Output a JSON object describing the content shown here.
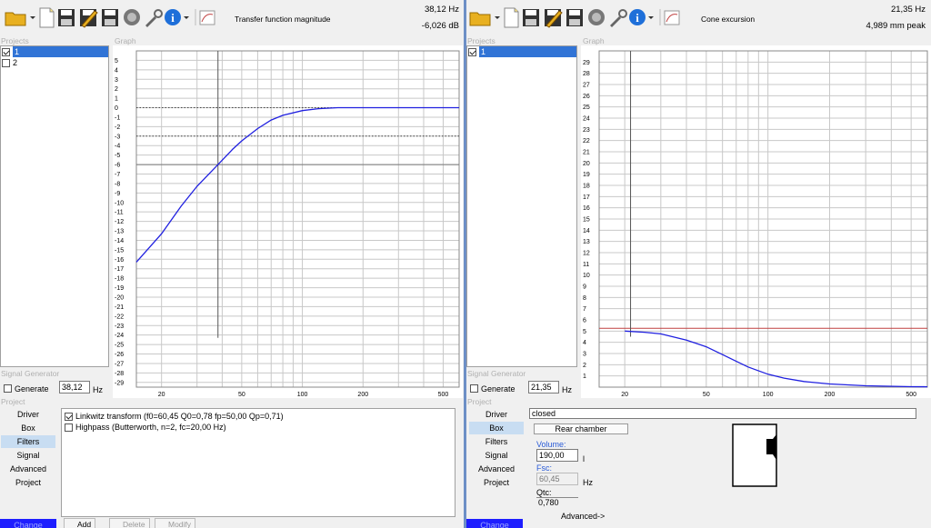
{
  "left": {
    "toolbar": {
      "title": "Transfer function magnitude",
      "readout_line1": "38,12 Hz",
      "readout_line2": "-6,026 dB"
    },
    "projects_label": "Projects",
    "graph_label": "Graph",
    "projects": [
      {
        "label": "1",
        "checked": true,
        "selected": true
      },
      {
        "label": "2",
        "checked": false,
        "selected": false
      }
    ],
    "signal_generator_label": "Signal Generator",
    "generate_label": "Generate",
    "generate_freq": "38,12",
    "generate_unit": "Hz",
    "project_label": "Project",
    "nav": [
      "Driver",
      "Box",
      "Filters",
      "Signal",
      "Advanced",
      "Project"
    ],
    "nav_selected": "Filters",
    "filters": [
      {
        "label": "Linkwitz transform (f0=60,45 Q0=0,78 fp=50,00 Qp=0,71)",
        "checked": true
      },
      {
        "label": "Highpass (Butterworth, n=2, fc=20,00 Hz)",
        "checked": false
      }
    ],
    "buttons": {
      "change": "Change",
      "add": "Add",
      "delete": "Delete",
      "modify": "Modify"
    }
  },
  "right": {
    "toolbar": {
      "title": "Cone excursion",
      "readout_line1": "21,35 Hz",
      "readout_line2": "4,989 mm peak"
    },
    "projects_label": "Projects",
    "graph_label": "Graph",
    "projects": [
      {
        "label": "1",
        "checked": true,
        "selected": true
      }
    ],
    "signal_generator_label": "Signal Generator",
    "generate_label": "Generate",
    "generate_freq": "21,35",
    "generate_unit": "Hz",
    "project_label": "Project",
    "nav": [
      "Driver",
      "Box",
      "Filters",
      "Signal",
      "Advanced",
      "Project"
    ],
    "nav_selected": "Box",
    "box": {
      "type": "closed",
      "rear_chamber": "Rear chamber",
      "volume_label": "Volume:",
      "volume_value": "190,00",
      "volume_unit": "l",
      "fsc_label": "Fsc:",
      "fsc_value": "60,45",
      "fsc_unit": "Hz",
      "qtc_label": "Qtc:",
      "qtc_value": "0,780",
      "advanced": "Advanced->"
    },
    "buttons": {
      "change": "Change"
    }
  },
  "chart_data": [
    {
      "type": "line",
      "title": "",
      "xlabel": "",
      "ylabel": "",
      "x_scale": "log",
      "xlim": [
        15,
        600
      ],
      "ylim": [
        -29.5,
        6
      ],
      "x_ticks": [
        "20",
        "50",
        "100",
        "200",
        "500"
      ],
      "y_ticks": [
        "5",
        "4",
        "3",
        "2",
        "1",
        "0",
        "-1",
        "-2",
        "-3",
        "-4",
        "-5",
        "-6",
        "-7",
        "-8",
        "-9",
        "-10",
        "-11",
        "-12",
        "-13",
        "-14",
        "-15",
        "-16",
        "-17",
        "-18",
        "-19",
        "-20",
        "-21",
        "-22",
        "-23",
        "-24",
        "-25",
        "-26",
        "-27",
        "-28",
        "-29"
      ],
      "grid": true,
      "series": [
        {
          "color": "#2020e0",
          "x": [
            15,
            20,
            25,
            30,
            38.12,
            45,
            50,
            60,
            70,
            80,
            100,
            120,
            150,
            200,
            300,
            500,
            600
          ],
          "y": [
            -16.3,
            -13.3,
            -10.4,
            -8.3,
            -6.0,
            -4.4,
            -3.5,
            -2.2,
            -1.3,
            -0.8,
            -0.3,
            -0.1,
            0,
            0,
            0,
            0,
            0
          ]
        }
      ],
      "reference_lines": [
        {
          "y": 0,
          "style": "dotted"
        },
        {
          "y": -3,
          "style": "dotted"
        }
      ],
      "cursor": {
        "x": 38.12,
        "y": -6.026
      }
    },
    {
      "type": "line",
      "title": "",
      "xlabel": "",
      "ylabel": "",
      "x_scale": "log",
      "xlim": [
        15,
        600
      ],
      "ylim": [
        0,
        30
      ],
      "x_ticks": [
        "20",
        "50",
        "100",
        "200",
        "500"
      ],
      "y_ticks": [
        "29",
        "28",
        "27",
        "26",
        "25",
        "24",
        "23",
        "22",
        "21",
        "20",
        "19",
        "18",
        "17",
        "16",
        "15",
        "14",
        "13",
        "12",
        "11",
        "10",
        "9",
        "8",
        "7",
        "6",
        "5",
        "4",
        "3",
        "2",
        "1"
      ],
      "grid": true,
      "series": [
        {
          "color": "#2020e0",
          "x": [
            20,
            25,
            30,
            40,
            50,
            60,
            70,
            80,
            100,
            120,
            150,
            200,
            300,
            500,
            600
          ],
          "y": [
            5.0,
            4.9,
            4.75,
            4.2,
            3.6,
            2.9,
            2.3,
            1.8,
            1.15,
            0.8,
            0.5,
            0.28,
            0.12,
            0.04,
            0.03
          ]
        }
      ],
      "reference_lines": [
        {
          "y": 5.25,
          "color": "#c04040"
        }
      ],
      "cursor": {
        "x": 21.35,
        "y": 4.989
      }
    }
  ]
}
